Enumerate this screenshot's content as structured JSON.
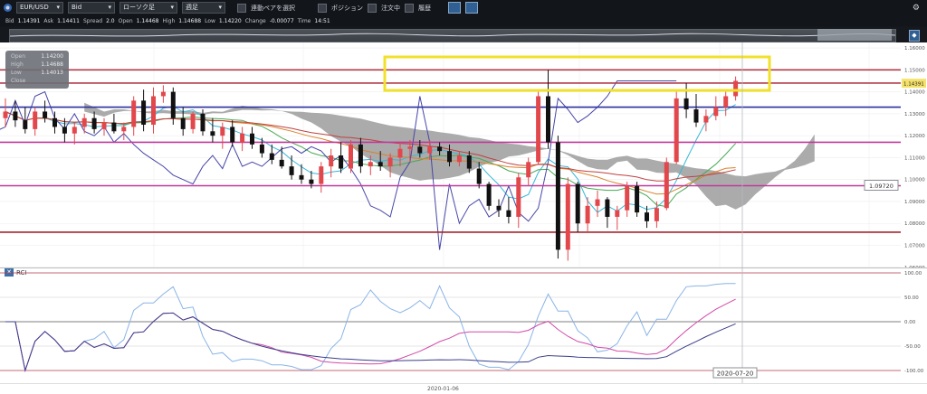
{
  "toolbar": {
    "symbol": "EUR/USD",
    "price_type": "Bid",
    "chart_kind": "ローソク足",
    "timeframe": "週足",
    "linked_pair_label": "連動ペアを選択",
    "position_label": "ポジション",
    "orders_label": "注文中",
    "history_label": "履歴"
  },
  "quote": {
    "bid_label": "Bid",
    "bid": "1.14391",
    "ask_label": "Ask",
    "ask": "1.14411",
    "spread_label": "Spread",
    "spread": "2.0",
    "open_label": "Open",
    "open": "1.14468",
    "high_label": "High",
    "high": "1.14688",
    "low_label": "Low",
    "low": "1.14220",
    "change_label": "Change",
    "change": "-0.00077",
    "time_label": "Time",
    "time": "14:51"
  },
  "ohlc_box": {
    "open_label": "Open",
    "open": "1.14200",
    "high_label": "High",
    "high": "1.14688",
    "low_label": "Low",
    "low": "1.14013",
    "close_label": "Close",
    "close": ""
  },
  "colors": {
    "bull": "#e2474c",
    "bear": "#111111",
    "cloud": "#9c9c9c",
    "highlight": "#f2e12a",
    "blue_line": "#2b2f9e",
    "magenta_line": "#c0399c",
    "red_line": "#a3262c"
  },
  "chart_data": {
    "type": "candlestick",
    "x_tick_labels": [
      "2020-01-06"
    ],
    "y_tick_labels": [
      "1.16000",
      "1.15000",
      "1.14000",
      "1.13000",
      "1.12000",
      "1.11000",
      "1.10000",
      "1.09000",
      "1.08000",
      "1.07000",
      "1.06000"
    ],
    "y_range": [
      1.0595,
      1.1625
    ],
    "current_price_label": "1.14391",
    "level_label": "1.09720",
    "crosshair_date_label": "2020-07-20",
    "horizontal_levels": [
      {
        "value": 1.15,
        "color": "#b23a4a"
      },
      {
        "value": 1.144,
        "color": "#b23a4a"
      },
      {
        "value": 1.133,
        "color": "#2b2f9e"
      },
      {
        "value": 1.117,
        "color": "#c0399c"
      },
      {
        "value": 1.0972,
        "color": "#c0399c"
      },
      {
        "value": 1.076,
        "color": "#a3262c"
      }
    ],
    "candles": [
      {
        "o": 1.128,
        "h": 1.137,
        "l": 1.124,
        "c": 1.131
      },
      {
        "o": 1.131,
        "h": 1.136,
        "l": 1.124,
        "c": 1.127
      },
      {
        "o": 1.127,
        "h": 1.133,
        "l": 1.121,
        "c": 1.123
      },
      {
        "o": 1.123,
        "h": 1.133,
        "l": 1.12,
        "c": 1.131
      },
      {
        "o": 1.131,
        "h": 1.136,
        "l": 1.126,
        "c": 1.128
      },
      {
        "o": 1.128,
        "h": 1.131,
        "l": 1.121,
        "c": 1.124
      },
      {
        "o": 1.124,
        "h": 1.128,
        "l": 1.117,
        "c": 1.121
      },
      {
        "o": 1.121,
        "h": 1.126,
        "l": 1.116,
        "c": 1.124
      },
      {
        "o": 1.124,
        "h": 1.13,
        "l": 1.121,
        "c": 1.128
      },
      {
        "o": 1.128,
        "h": 1.131,
        "l": 1.121,
        "c": 1.123
      },
      {
        "o": 1.123,
        "h": 1.128,
        "l": 1.12,
        "c": 1.126
      },
      {
        "o": 1.126,
        "h": 1.13,
        "l": 1.121,
        "c": 1.122
      },
      {
        "o": 1.122,
        "h": 1.126,
        "l": 1.118,
        "c": 1.124
      },
      {
        "o": 1.124,
        "h": 1.138,
        "l": 1.12,
        "c": 1.136
      },
      {
        "o": 1.136,
        "h": 1.141,
        "l": 1.122,
        "c": 1.125
      },
      {
        "o": 1.125,
        "h": 1.142,
        "l": 1.121,
        "c": 1.138
      },
      {
        "o": 1.138,
        "h": 1.143,
        "l": 1.135,
        "c": 1.14
      },
      {
        "o": 1.14,
        "h": 1.142,
        "l": 1.125,
        "c": 1.128
      },
      {
        "o": 1.128,
        "h": 1.133,
        "l": 1.12,
        "c": 1.123
      },
      {
        "o": 1.123,
        "h": 1.131,
        "l": 1.121,
        "c": 1.13
      },
      {
        "o": 1.13,
        "h": 1.132,
        "l": 1.12,
        "c": 1.122
      },
      {
        "o": 1.122,
        "h": 1.128,
        "l": 1.117,
        "c": 1.12
      },
      {
        "o": 1.12,
        "h": 1.126,
        "l": 1.114,
        "c": 1.124
      },
      {
        "o": 1.124,
        "h": 1.127,
        "l": 1.115,
        "c": 1.117
      },
      {
        "o": 1.117,
        "h": 1.124,
        "l": 1.113,
        "c": 1.121
      },
      {
        "o": 1.121,
        "h": 1.124,
        "l": 1.114,
        "c": 1.116
      },
      {
        "o": 1.116,
        "h": 1.119,
        "l": 1.11,
        "c": 1.112
      },
      {
        "o": 1.112,
        "h": 1.116,
        "l": 1.107,
        "c": 1.109
      },
      {
        "o": 1.109,
        "h": 1.115,
        "l": 1.105,
        "c": 1.106
      },
      {
        "o": 1.106,
        "h": 1.111,
        "l": 1.1,
        "c": 1.102
      },
      {
        "o": 1.102,
        "h": 1.107,
        "l": 1.098,
        "c": 1.1
      },
      {
        "o": 1.1,
        "h": 1.104,
        "l": 1.096,
        "c": 1.098
      },
      {
        "o": 1.098,
        "h": 1.108,
        "l": 1.094,
        "c": 1.106
      },
      {
        "o": 1.106,
        "h": 1.114,
        "l": 1.101,
        "c": 1.111
      },
      {
        "o": 1.111,
        "h": 1.117,
        "l": 1.103,
        "c": 1.105
      },
      {
        "o": 1.105,
        "h": 1.118,
        "l": 1.103,
        "c": 1.116
      },
      {
        "o": 1.116,
        "h": 1.119,
        "l": 1.103,
        "c": 1.106
      },
      {
        "o": 1.106,
        "h": 1.111,
        "l": 1.102,
        "c": 1.108
      },
      {
        "o": 1.108,
        "h": 1.113,
        "l": 1.104,
        "c": 1.106
      },
      {
        "o": 1.106,
        "h": 1.112,
        "l": 1.101,
        "c": 1.11
      },
      {
        "o": 1.11,
        "h": 1.117,
        "l": 1.106,
        "c": 1.114
      },
      {
        "o": 1.114,
        "h": 1.118,
        "l": 1.108,
        "c": 1.115
      },
      {
        "o": 1.115,
        "h": 1.118,
        "l": 1.11,
        "c": 1.112
      },
      {
        "o": 1.112,
        "h": 1.118,
        "l": 1.109,
        "c": 1.115
      },
      {
        "o": 1.115,
        "h": 1.117,
        "l": 1.111,
        "c": 1.113
      },
      {
        "o": 1.113,
        "h": 1.116,
        "l": 1.106,
        "c": 1.108
      },
      {
        "o": 1.108,
        "h": 1.113,
        "l": 1.106,
        "c": 1.111
      },
      {
        "o": 1.111,
        "h": 1.113,
        "l": 1.103,
        "c": 1.105
      },
      {
        "o": 1.105,
        "h": 1.108,
        "l": 1.096,
        "c": 1.098
      },
      {
        "o": 1.098,
        "h": 1.099,
        "l": 1.086,
        "c": 1.088
      },
      {
        "o": 1.088,
        "h": 1.091,
        "l": 1.083,
        "c": 1.086
      },
      {
        "o": 1.086,
        "h": 1.092,
        "l": 1.08,
        "c": 1.083
      },
      {
        "o": 1.083,
        "h": 1.103,
        "l": 1.078,
        "c": 1.101
      },
      {
        "o": 1.101,
        "h": 1.11,
        "l": 1.097,
        "c": 1.108
      },
      {
        "o": 1.108,
        "h": 1.14,
        "l": 1.107,
        "c": 1.138
      },
      {
        "o": 1.138,
        "h": 1.15,
        "l": 1.114,
        "c": 1.117
      },
      {
        "o": 1.117,
        "h": 1.12,
        "l": 1.064,
        "c": 1.068
      },
      {
        "o": 1.068,
        "h": 1.101,
        "l": 1.063,
        "c": 1.098
      },
      {
        "o": 1.098,
        "h": 1.099,
        "l": 1.076,
        "c": 1.08
      },
      {
        "o": 1.08,
        "h": 1.092,
        "l": 1.076,
        "c": 1.088
      },
      {
        "o": 1.088,
        "h": 1.095,
        "l": 1.083,
        "c": 1.091
      },
      {
        "o": 1.091,
        "h": 1.092,
        "l": 1.078,
        "c": 1.083
      },
      {
        "o": 1.083,
        "h": 1.088,
        "l": 1.077,
        "c": 1.086
      },
      {
        "o": 1.086,
        "h": 1.099,
        "l": 1.083,
        "c": 1.097
      },
      {
        "o": 1.097,
        "h": 1.099,
        "l": 1.083,
        "c": 1.085
      },
      {
        "o": 1.085,
        "h": 1.088,
        "l": 1.078,
        "c": 1.081
      },
      {
        "o": 1.081,
        "h": 1.09,
        "l": 1.078,
        "c": 1.087
      },
      {
        "o": 1.087,
        "h": 1.11,
        "l": 1.086,
        "c": 1.108
      },
      {
        "o": 1.108,
        "h": 1.14,
        "l": 1.107,
        "c": 1.137
      },
      {
        "o": 1.137,
        "h": 1.144,
        "l": 1.128,
        "c": 1.132
      },
      {
        "o": 1.132,
        "h": 1.139,
        "l": 1.124,
        "c": 1.126
      },
      {
        "o": 1.126,
        "h": 1.132,
        "l": 1.122,
        "c": 1.129
      },
      {
        "o": 1.129,
        "h": 1.138,
        "l": 1.127,
        "c": 1.133
      },
      {
        "o": 1.133,
        "h": 1.14,
        "l": 1.129,
        "c": 1.138
      },
      {
        "o": 1.138,
        "h": 1.147,
        "l": 1.136,
        "c": 1.145
      }
    ],
    "rsi": {
      "label": "RCI",
      "y_tick_labels": [
        "100.00",
        "50.00",
        "0.00",
        "-50.00",
        "-100.00"
      ],
      "y_range": [
        -100,
        100
      ]
    }
  }
}
